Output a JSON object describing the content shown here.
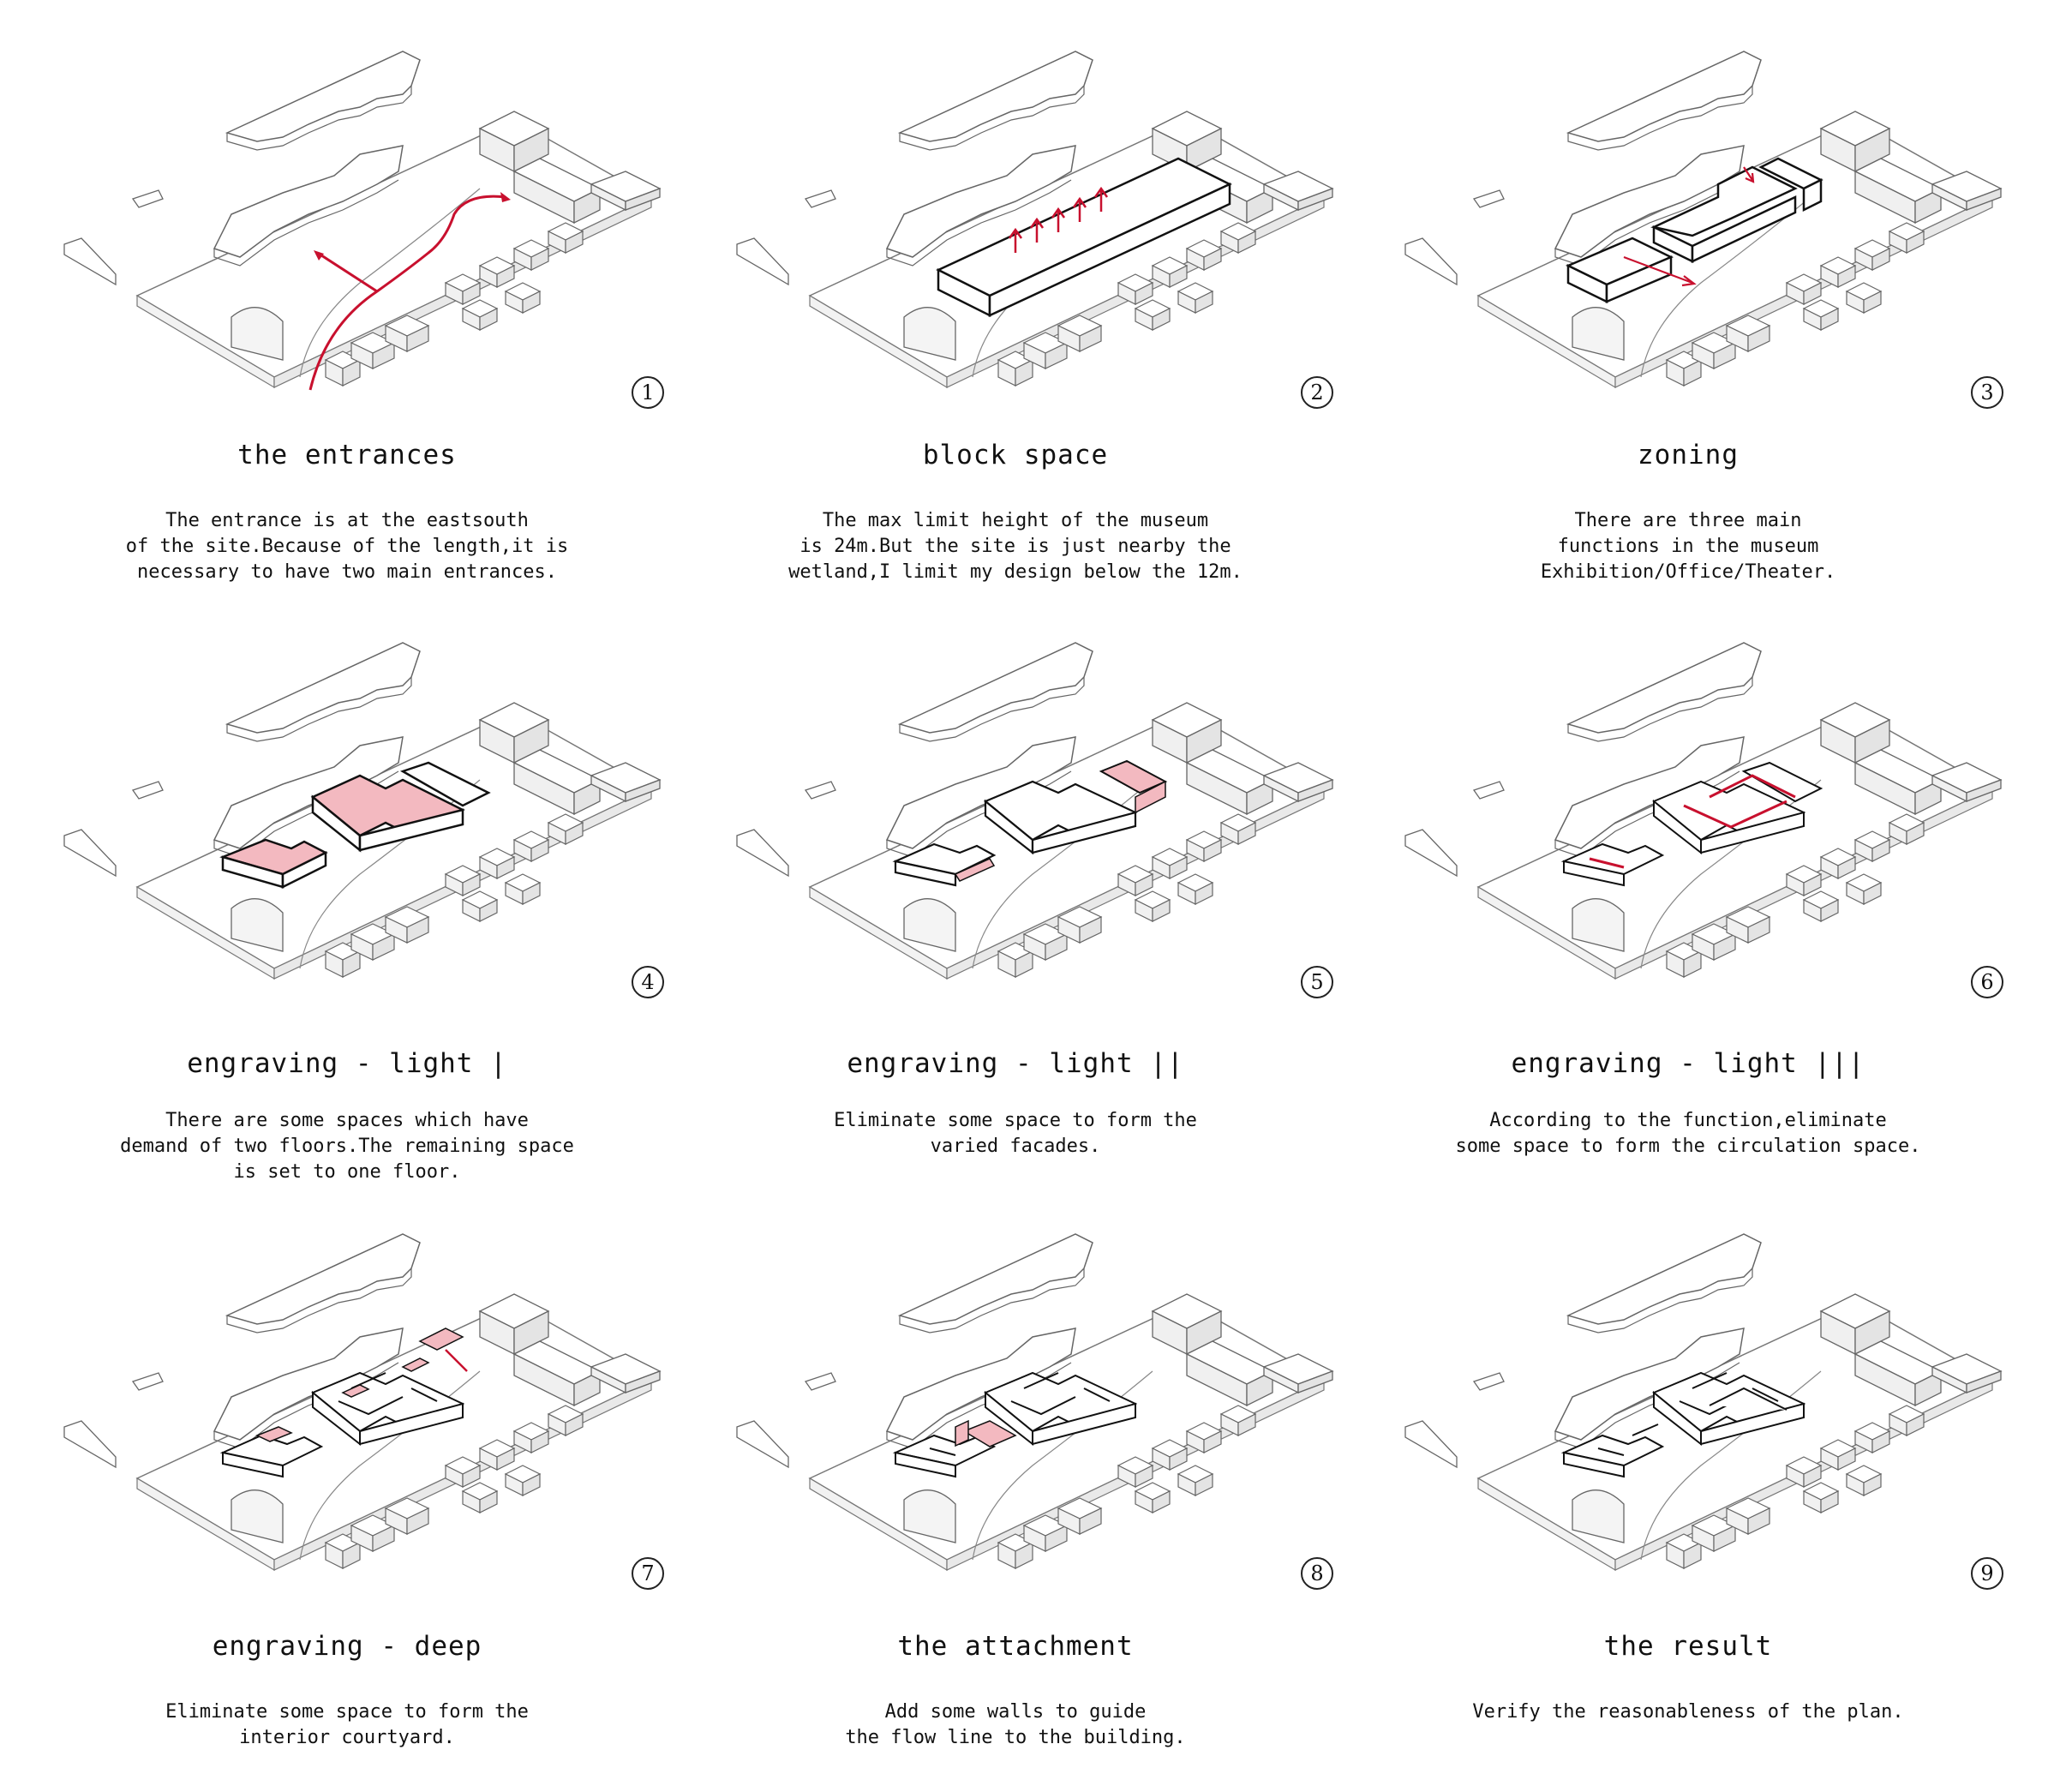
{
  "accent_color": "#c8102e",
  "highlight_fill": "#f3b9c0",
  "panels": [
    {
      "number": "1",
      "title": "the entrances",
      "desc": "The entrance is at the eastsouth\nof the site.Because of the length,it is\nnecessary to have two main entrances."
    },
    {
      "number": "2",
      "title": "block space",
      "desc": "The max limit height of the museum\nis 24m.But the site is just nearby the\nwetland,I limit my design below the 12m."
    },
    {
      "number": "3",
      "title": "zoning",
      "desc": "There are three main\nfunctions in the museum\nExhibition/Office/Theater."
    },
    {
      "number": "4",
      "title": "engraving - light |",
      "desc": "There are some spaces which have\ndemand of two floors.The remaining space\nis set to one floor."
    },
    {
      "number": "5",
      "title": "engraving - light ||",
      "desc": "Eliminate some space to form the\nvaried facades."
    },
    {
      "number": "6",
      "title": "engraving - light |||",
      "desc": "According to the function,eliminate\nsome space to form the circulation space."
    },
    {
      "number": "7",
      "title": "engraving - deep",
      "desc": "Eliminate some space to form the\ninterior courtyard."
    },
    {
      "number": "8",
      "title": "the attachment",
      "desc": "Add some walls to guide\nthe flow line to the building."
    },
    {
      "number": "9",
      "title": "the result",
      "desc": "Verify the reasonableness of the plan."
    }
  ]
}
